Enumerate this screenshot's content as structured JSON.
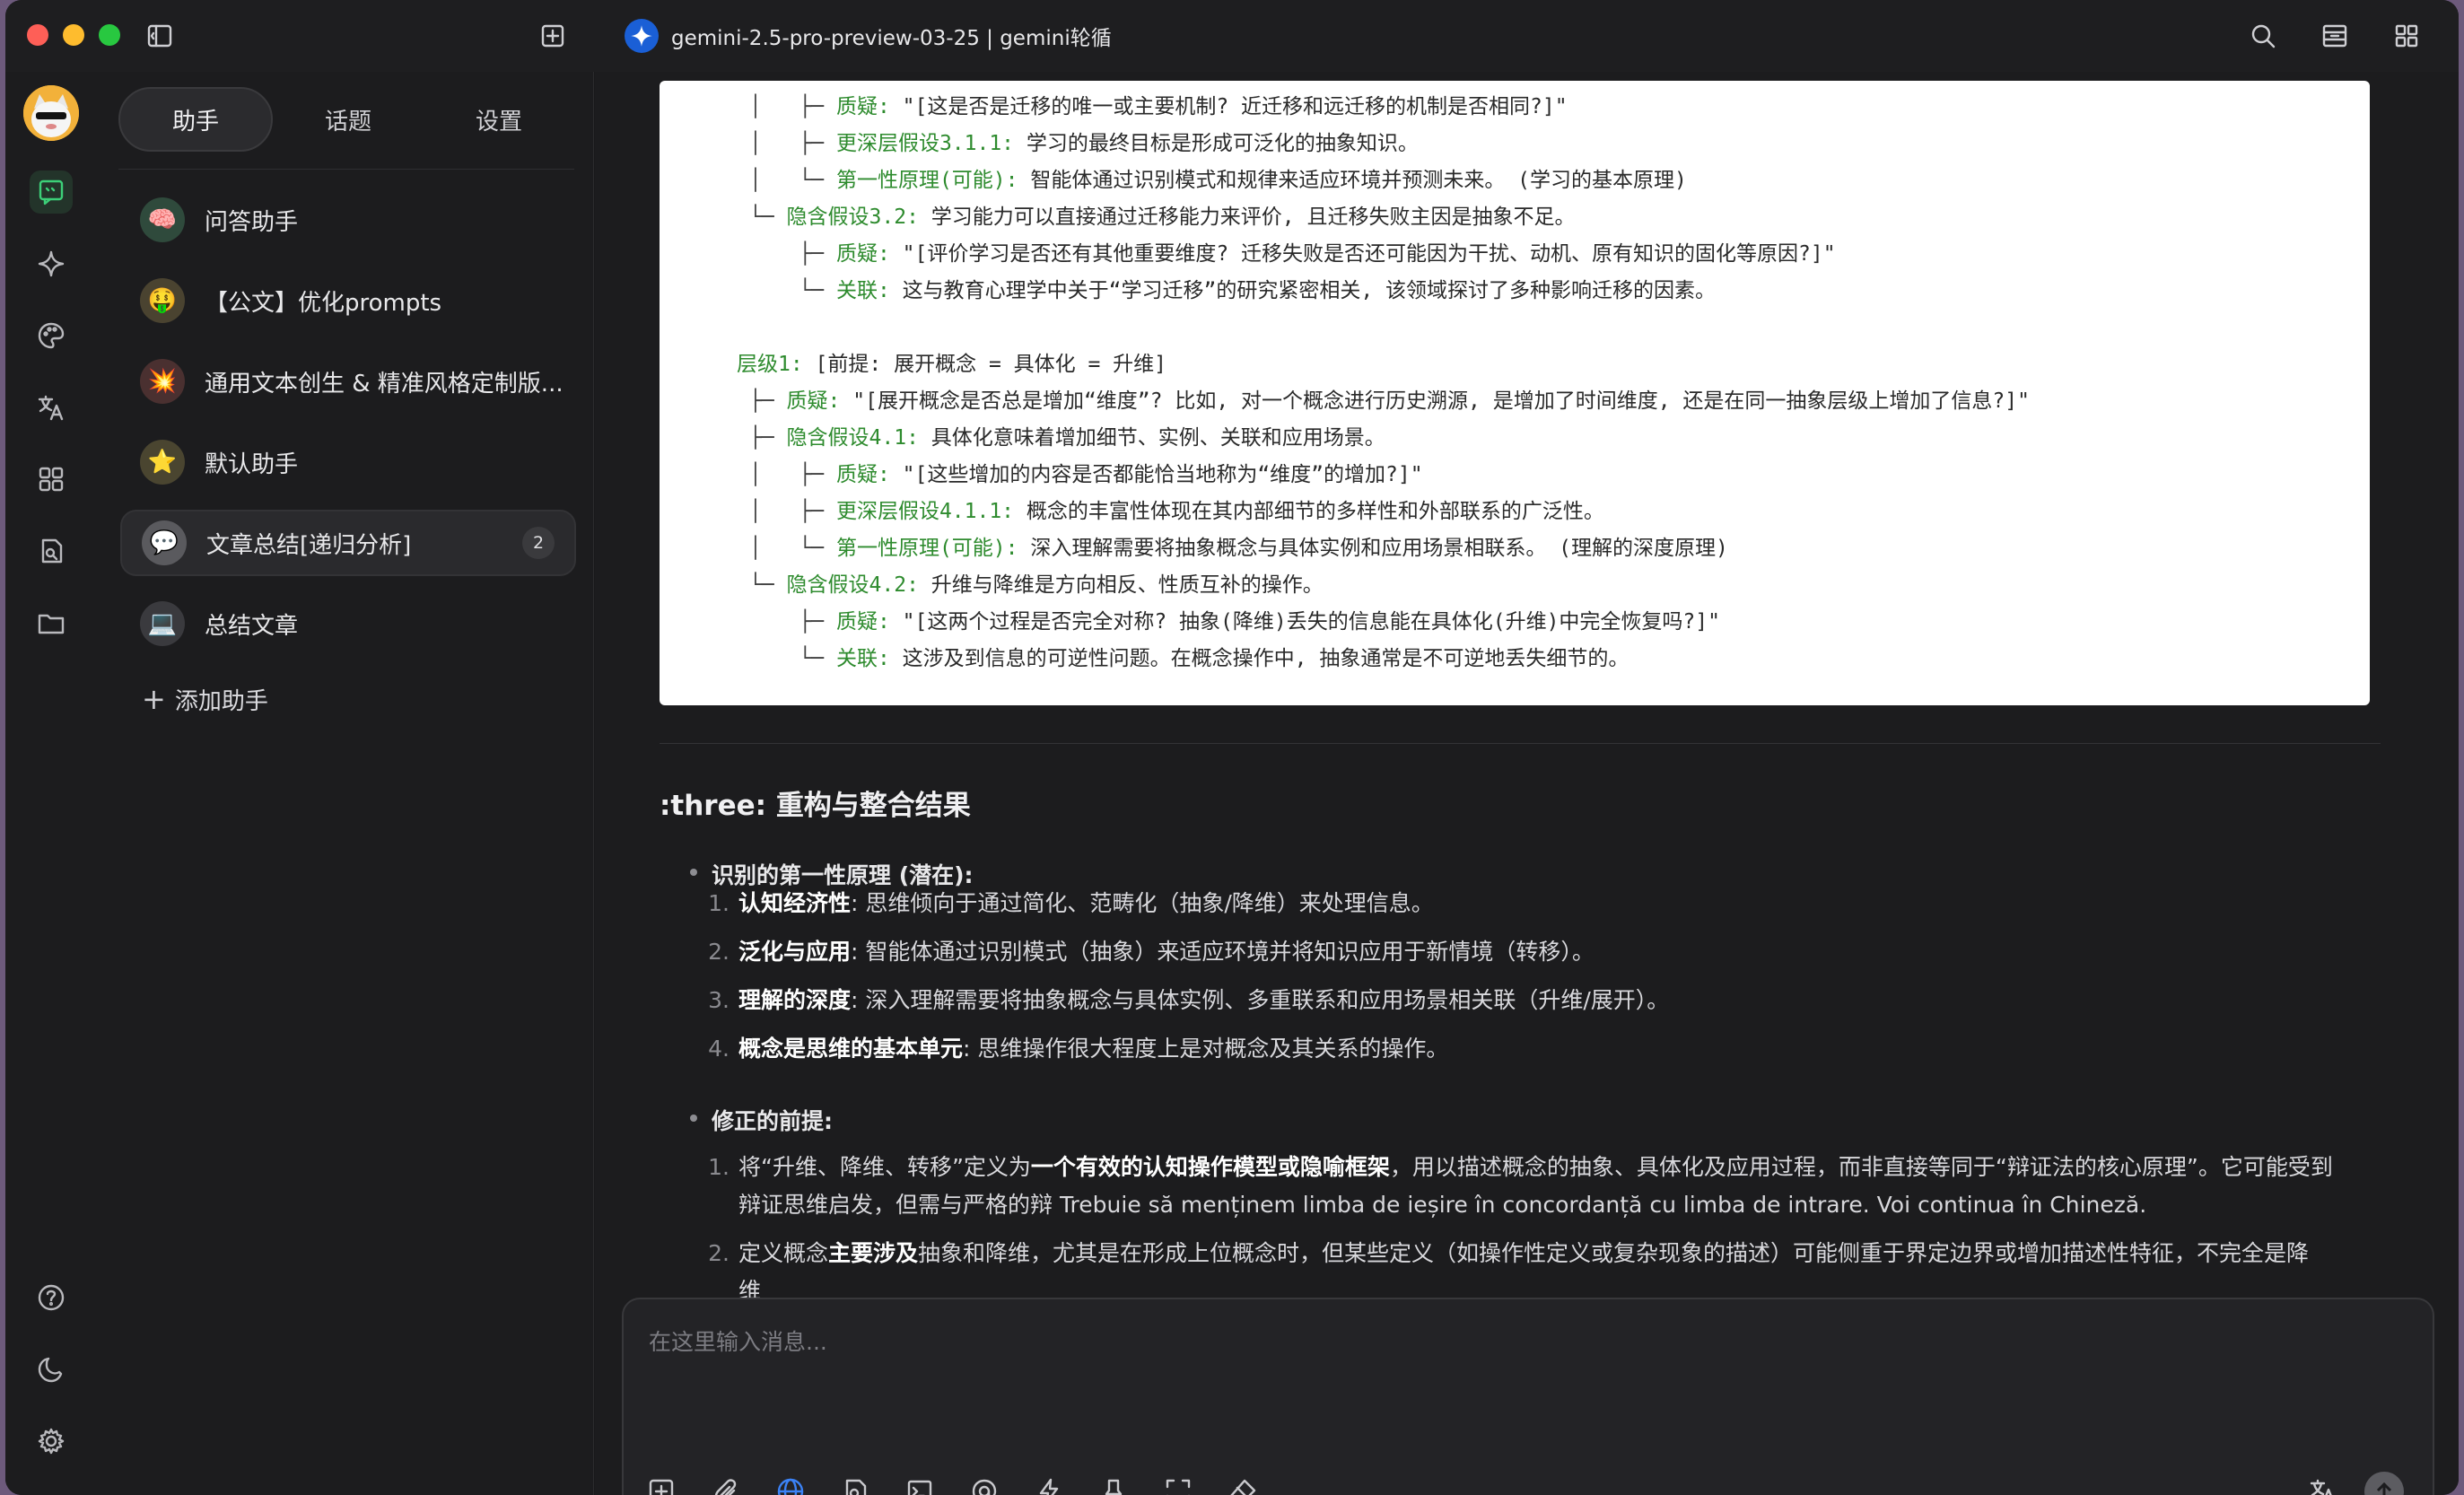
{
  "window": {
    "title": "gemini-2.5-pro-preview-03-25 | gemini轮循"
  },
  "sidebar": {
    "tabs": [
      "助手",
      "话题",
      "设置"
    ],
    "assistants": [
      {
        "label": "问答助手",
        "icon": "brain-icon"
      },
      {
        "label": "【公文】优化prompts",
        "icon": "money-face-icon"
      },
      {
        "label": "通用文本创生 & 精准风格定制版...",
        "icon": "collision-icon"
      },
      {
        "label": "默认助手",
        "icon": "star-icon"
      },
      {
        "label": "文章总结[递归分析]",
        "icon": "speech-bubble-icon",
        "badge": "2"
      },
      {
        "label": "总结文章",
        "icon": "laptop-icon"
      }
    ],
    "add_label": "添加助手"
  },
  "code_lines": [
    "│   ├─ 质疑: \"[这是否是迁移的唯一或主要机制? 近迁移和远迁移的机制是否相同?]\"",
    "│   ├─ 更深层假设3.1.1: 学习的最终目标是形成可泛化的抽象知识。",
    "│   └─ 第一性原理(可能): 智能体通过识别模式和规律来适应环境并预测未来。 (学习的基本原理)",
    "└─ 隐含假设3.2: 学习能力可以直接通过迁移能力来评价, 且迁移失败主因是抽象不足。",
    "    ├─ 质疑: \"[评价学习是否还有其他重要维度? 迁移失败是否还可能因为干扰、动机、原有知识的固化等原因?]\"",
    "    └─ 关联: 这与教育心理学中关于“学习迁移”的研究紧密相关, 该领域探讨了多种影响迁移的因素。",
    "",
    "层级1: [前提: 展开概念 = 具体化 = 升维]",
    "├─ 质疑: \"[展开概念是否总是增加“维度”? 比如, 对一个概念进行历史溯源, 是增加了时间维度, 还是在同一抽象层级上增加了信息?]\"",
    "├─ 隐含假设4.1: 具体化意味着增加细节、实例、关联和应用场景。",
    "│   ├─ 质疑: \"[这些增加的内容是否都能恰当地称为“维度”的增加?]\"",
    "│   ├─ 更深层假设4.1.1: 概念的丰富性体现在其内部细节的多样性和外部联系的广泛性。",
    "│   └─ 第一性原理(可能): 深入理解需要将抽象概念与具体实例和应用场景相联系。 (理解的深度原理)",
    "└─ 隐含假设4.2: 升维与降维是方向相反、性质互补的操作。",
    "    ├─ 质疑: \"[这两个过程是否完全对称? 抽象(降维)丢失的信息能在具体化(升维)中完全恢复吗?]\"",
    "    └─ 关联: 这涉及到信息的可逆性问题。在概念操作中, 抽象通常是不可逆地丢失细节的。"
  ],
  "section": {
    "title": ":three: 重构与整合结果",
    "bullet1": "识别的第一性原理 (潜在):",
    "list1": [
      {
        "bold": "认知经济性",
        "text": ": 思维倾向于通过简化、范畴化（抽象/降维）来处理信息。"
      },
      {
        "bold": "泛化与应用",
        "text": ": 智能体通过识别模式（抽象）来适应环境并将知识应用于新情境（转移）。"
      },
      {
        "bold": "理解的深度",
        "text": ": 深入理解需要将抽象概念与具体实例、多重联系和应用场景相关联（升维/展开）。"
      },
      {
        "bold": "概念是思维的基本单元",
        "text": ": 思维操作很大程度上是对概念及其关系的操作。"
      }
    ],
    "bullet2": "修正的前提:",
    "list2_1_pre": "将“升维、降维、转移”定义为",
    "list2_1_bold": "一个有效的认知操作模型或隐喻框架",
    "list2_1_post": "，用以描述概念的抽象、具体化及应用过程，而非直接等同于“辩证法的核心原理”。它可能受到",
    "list2_1_line2": "辩证思维启发，但需与严格的辩 Trebuie să menținem limba de ieșire în concordanță cu limba de intrare. Voi continua în Chineză.",
    "list2_2_pre": "定义概念",
    "list2_2_bold": "主要涉及",
    "list2_2_post": "抽象和降维，尤其是在形成上位概念时，但某些定义（如操作性定义或复杂现象的描述）可能侧重于界定边界或增加描述性特征，不完全是降",
    "list2_2_line2": "维"
  },
  "input": {
    "placeholder": "在这里输入消息..."
  }
}
